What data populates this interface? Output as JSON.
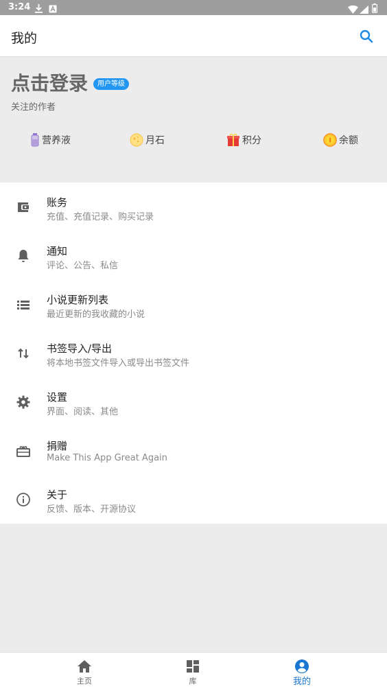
{
  "status_bar": {
    "time": "3:24"
  },
  "app_bar": {
    "title": "我的",
    "search_icon": "search-icon",
    "accent": "#1e88e5"
  },
  "profile": {
    "login_text": "点击登录",
    "level_badge": "用户等级",
    "follow_text": "关注的作者",
    "stats": [
      {
        "label": "营养液",
        "icon": "nutrient-bottle-icon"
      },
      {
        "label": "月石",
        "icon": "moonstone-icon"
      },
      {
        "label": "积分",
        "icon": "gift-icon"
      },
      {
        "label": "余额",
        "icon": "coin-icon"
      }
    ]
  },
  "menu": [
    {
      "title": "账务",
      "subtitle": "充值、充值记录、购买记录",
      "icon": "wallet-icon"
    },
    {
      "title": "通知",
      "subtitle": "评论、公告、私信",
      "icon": "bell-icon"
    },
    {
      "title": "小说更新列表",
      "subtitle": "最近更新的我收藏的小说",
      "icon": "list-icon"
    },
    {
      "title": "书签导入/导出",
      "subtitle": "将本地书签文件导入或导出书签文件",
      "icon": "import-export-icon"
    },
    {
      "title": "设置",
      "subtitle": "界面、阅读、其他",
      "icon": "gear-icon"
    },
    {
      "title": "捐赠",
      "subtitle": "Make This App Great Again",
      "icon": "donate-icon"
    },
    {
      "title": "关于",
      "subtitle": "反馈、版本、开源协议",
      "icon": "info-icon"
    }
  ],
  "bottom_nav": [
    {
      "label": "主页",
      "icon": "home-icon",
      "active": false
    },
    {
      "label": "库",
      "icon": "library-icon",
      "active": false
    },
    {
      "label": "我的",
      "icon": "account-icon",
      "active": true
    }
  ],
  "colors": {
    "active_tab": "#1976d2",
    "badge": "#2196f3",
    "status_bar": "#9e9e9e"
  }
}
